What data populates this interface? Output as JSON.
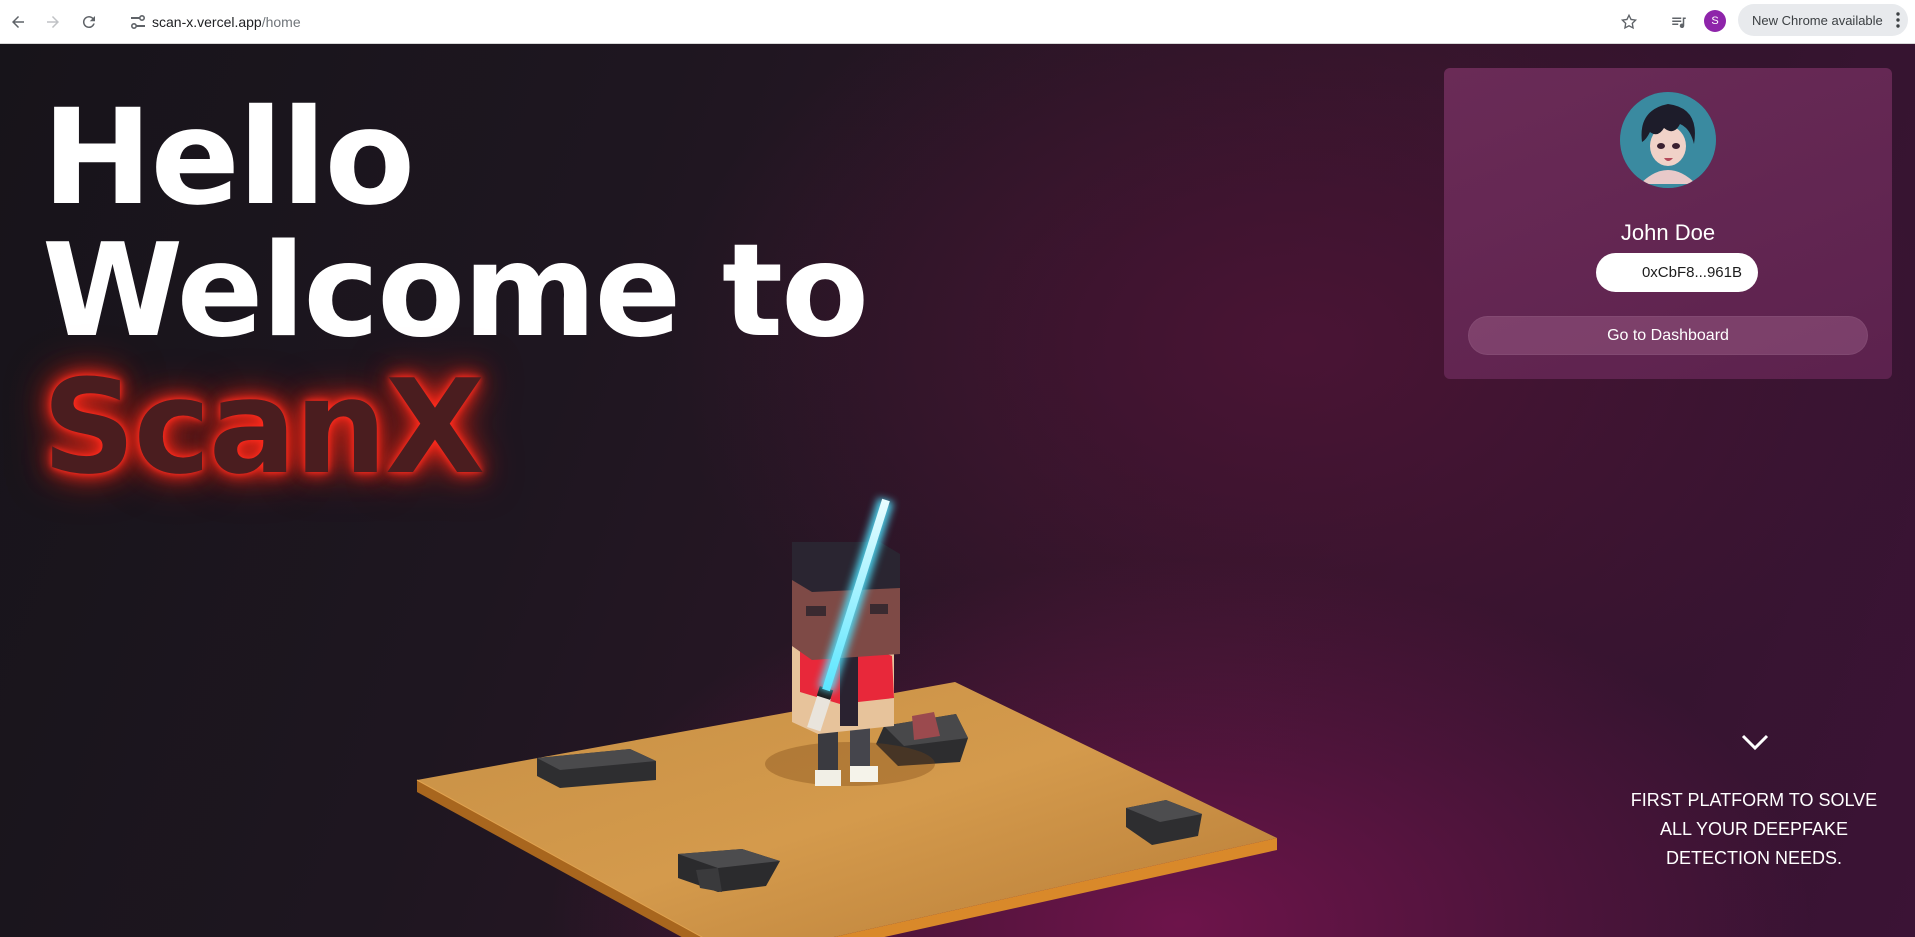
{
  "browser": {
    "url_host": "scan-x.vercel.app",
    "url_path": "/home",
    "profile_initial": "S",
    "update_label": "New Chrome available"
  },
  "hero": {
    "line1": "Hello",
    "line2": "Welcome to",
    "brand": "ScanX",
    "brand_glow_color": "#ff2b1e"
  },
  "profile": {
    "name": "John Doe",
    "wallet": "0xCbF8...961B",
    "dashboard_button": "Go to Dashboard"
  },
  "tagline": {
    "line1": "FIRST PLATFORM TO SOLVE",
    "line2": "ALL YOUR DEEPFAKE",
    "line3": "DETECTION NEEDS."
  },
  "colors": {
    "accent_purple": "#8e24aa",
    "lightsaber": "#4fe3ff",
    "platform": "#c98a3a"
  }
}
